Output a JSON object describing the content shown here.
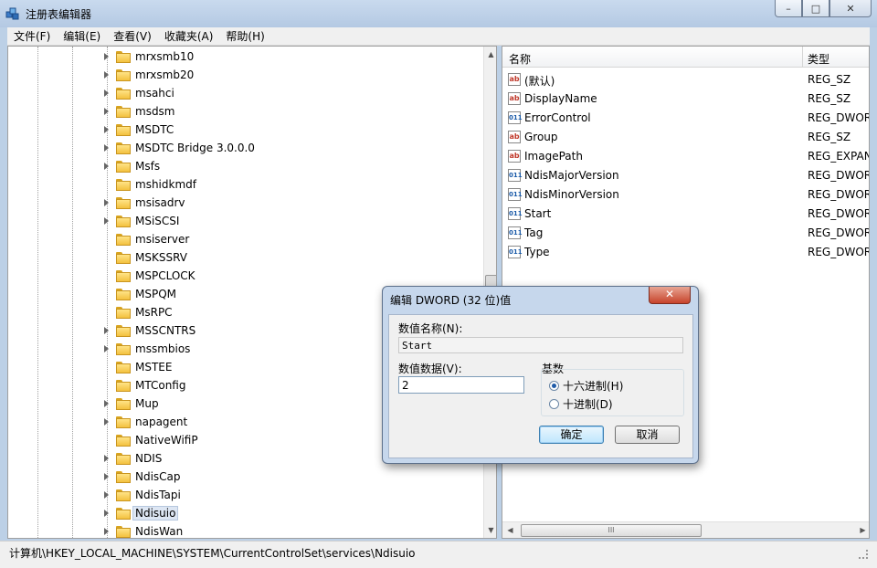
{
  "window": {
    "title": "注册表编辑器",
    "controls": {
      "minimize": "–",
      "maximize": "□",
      "close": "✕"
    }
  },
  "menu": [
    "文件(F)",
    "编辑(E)",
    "查看(V)",
    "收藏夹(A)",
    "帮助(H)"
  ],
  "tree": {
    "items": [
      {
        "label": "mrxsmb10",
        "expandable": true
      },
      {
        "label": "mrxsmb20",
        "expandable": true
      },
      {
        "label": "msahci",
        "expandable": true
      },
      {
        "label": "msdsm",
        "expandable": true
      },
      {
        "label": "MSDTC",
        "expandable": true
      },
      {
        "label": "MSDTC Bridge 3.0.0.0",
        "expandable": true
      },
      {
        "label": "Msfs",
        "expandable": true
      },
      {
        "label": "mshidkmdf",
        "expandable": false
      },
      {
        "label": "msisadrv",
        "expandable": true
      },
      {
        "label": "MSiSCSI",
        "expandable": true
      },
      {
        "label": "msiserver",
        "expandable": false
      },
      {
        "label": "MSKSSRV",
        "expandable": false
      },
      {
        "label": "MSPCLOCK",
        "expandable": false
      },
      {
        "label": "MSPQM",
        "expandable": false
      },
      {
        "label": "MsRPC",
        "expandable": false
      },
      {
        "label": "MSSCNTRS",
        "expandable": true
      },
      {
        "label": "mssmbios",
        "expandable": true
      },
      {
        "label": "MSTEE",
        "expandable": false
      },
      {
        "label": "MTConfig",
        "expandable": false
      },
      {
        "label": "Mup",
        "expandable": true
      },
      {
        "label": "napagent",
        "expandable": true
      },
      {
        "label": "NativeWifiP",
        "expandable": false
      },
      {
        "label": "NDIS",
        "expandable": true
      },
      {
        "label": "NdisCap",
        "expandable": true
      },
      {
        "label": "NdisTapi",
        "expandable": true
      },
      {
        "label": "Ndisuio",
        "expandable": true,
        "selected": true
      },
      {
        "label": "NdisWan",
        "expandable": true
      }
    ],
    "scroll_up": "▲",
    "scroll_down": "▼"
  },
  "values": {
    "headers": {
      "name": "名称",
      "type": "类型"
    },
    "rows": [
      {
        "icon": "ab",
        "name": "(默认)",
        "type": "REG_SZ"
      },
      {
        "icon": "ab",
        "name": "DisplayName",
        "type": "REG_SZ"
      },
      {
        "icon": "dw",
        "name": "ErrorControl",
        "type": "REG_DWORD"
      },
      {
        "icon": "ab",
        "name": "Group",
        "type": "REG_SZ"
      },
      {
        "icon": "ab",
        "name": "ImagePath",
        "type": "REG_EXPAND_SZ"
      },
      {
        "icon": "dw",
        "name": "NdisMajorVersion",
        "type": "REG_DWORD"
      },
      {
        "icon": "dw",
        "name": "NdisMinorVersion",
        "type": "REG_DWORD"
      },
      {
        "icon": "dw",
        "name": "Start",
        "type": "REG_DWORD"
      },
      {
        "icon": "dw",
        "name": "Tag",
        "type": "REG_DWORD"
      },
      {
        "icon": "dw",
        "name": "Type",
        "type": "REG_DWORD"
      }
    ],
    "icon_text": {
      "ab": "ab",
      "dw": "011"
    },
    "scroll_left": "◀",
    "scroll_right": "▶",
    "thumb_grip": "III"
  },
  "status": {
    "path": "计算机\\HKEY_LOCAL_MACHINE\\SYSTEM\\CurrentControlSet\\services\\Ndisuio"
  },
  "dialog": {
    "title": "编辑 DWORD (32 位)值",
    "close": "✕",
    "name_label": "数值名称(N):",
    "name_value": "Start",
    "data_label": "数值数据(V):",
    "data_value": "2",
    "base_label": "基数",
    "hex_label": "十六进制(H)",
    "dec_label": "十进制(D)",
    "ok": "确定",
    "cancel": "取消"
  }
}
